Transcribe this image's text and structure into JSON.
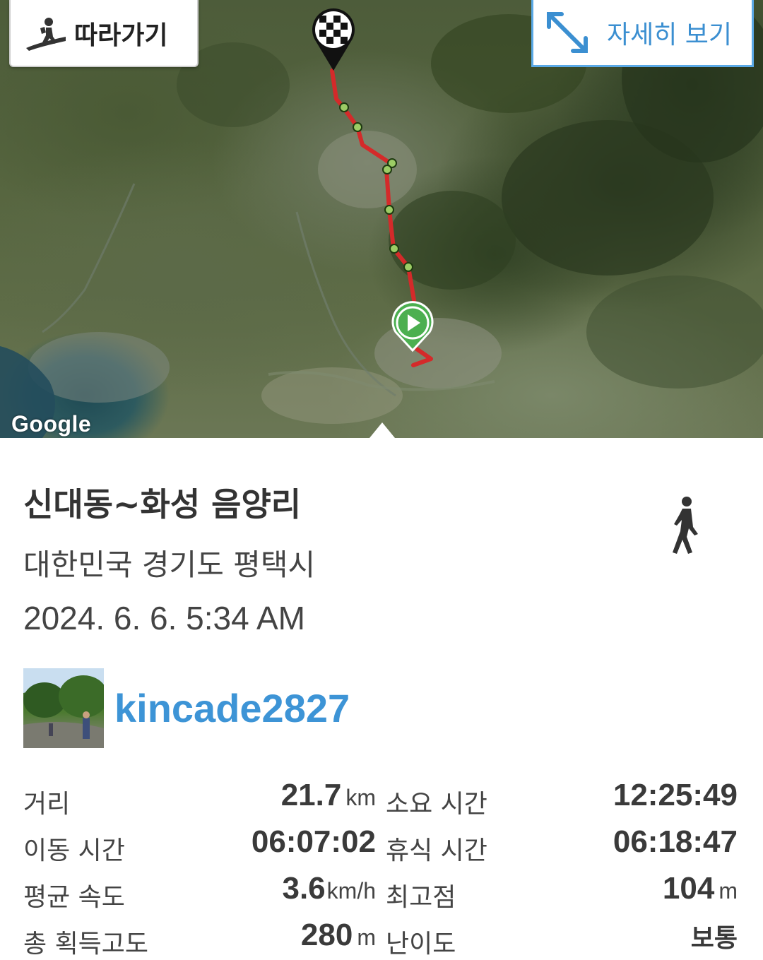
{
  "map": {
    "follow_button": "따라가기",
    "detail_button": "자세히 보기",
    "attribution": "Google"
  },
  "trail": {
    "title": "신대동~화성 음양리",
    "location": "대한민국 경기도 평택시",
    "datetime": "2024. 6. 6. 5:34 AM",
    "activity_icon": "walking-person-icon",
    "user": "kincade2827"
  },
  "stats": {
    "distance_label": "거리",
    "distance_value": "21.7",
    "distance_unit": "km",
    "duration_label": "소요 시간",
    "duration_value": "12:25:49",
    "moving_label": "이동 시간",
    "moving_value": "06:07:02",
    "rest_label": "휴식 시간",
    "rest_value": "06:18:47",
    "speed_label": "평균 속도",
    "speed_value": "3.6",
    "speed_unit": "km/h",
    "max_alt_label": "최고점",
    "max_alt_value": "104",
    "max_alt_unit": "m",
    "gain_label": "총 획득고도",
    "gain_value": "280",
    "gain_unit": "m",
    "difficulty_label": "난이도",
    "difficulty_value": "보통"
  },
  "colors": {
    "route": "#d42a2a",
    "accent": "#3d94d6",
    "start_marker": "#4caf50",
    "waypoint": "#8bc34a"
  }
}
